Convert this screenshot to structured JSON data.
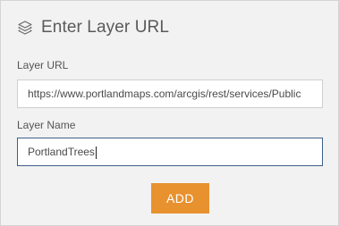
{
  "header": {
    "icon": "layers-icon",
    "title": "Enter Layer URL"
  },
  "form": {
    "layer_url": {
      "label": "Layer URL",
      "value": "https://www.portlandmaps.com/arcgis/rest/services/Public"
    },
    "layer_name": {
      "label": "Layer Name",
      "value": "PortlandTrees"
    },
    "add_label": "ADD"
  },
  "colors": {
    "panel_bg": "#f2f2f2",
    "accent_button": "#e8912f",
    "focus_border": "#3e5f8a"
  }
}
